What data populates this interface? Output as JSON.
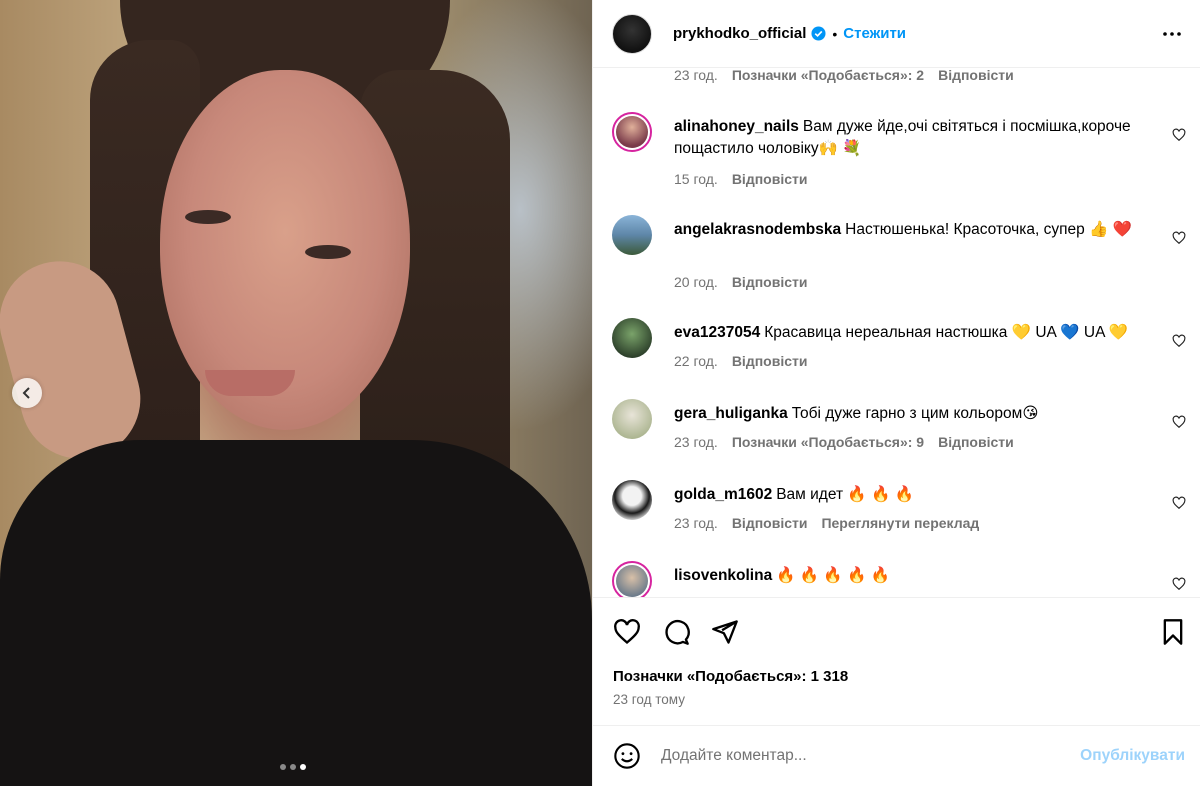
{
  "post": {
    "username": "prykhodko_official",
    "separator": "•",
    "follow_label": "Стежити",
    "carousel": {
      "total": 3,
      "active": 3
    }
  },
  "colors": {
    "accent": "#0095f6",
    "secondary_text": "#737373",
    "story_ring": "#d6249f"
  },
  "top_meta": {
    "time": "23 год.",
    "likes": "Позначки «Подобається»: 2",
    "reply": "Відповісти"
  },
  "comments": [
    {
      "user": "alinahoney_nails",
      "text": "Вам дуже йде,очі світяться і посмішка,короче пощастило чоловіку🙌 💐",
      "time": "15 год.",
      "likes": "",
      "reply": "Відповісти",
      "extra": ""
    },
    {
      "user": "angelakrasnodembska",
      "text": "Настюшенька! Красоточка, супер 👍 ❤️",
      "time": "20 год.",
      "likes": "",
      "reply": "Відповісти",
      "extra": ""
    },
    {
      "user": "eva1237054",
      "text": "Красавица нереальная настюшка 💛 UA 💙 UA 💛",
      "time": "22 год.",
      "likes": "",
      "reply": "Відповісти",
      "extra": ""
    },
    {
      "user": "gera_huliganka",
      "text": "Тобі дуже гарно з цим кольором😘",
      "time": "23 год.",
      "likes": "Позначки «Подобається»: 9",
      "reply": "Відповісти",
      "extra": ""
    },
    {
      "user": "golda_m1602",
      "text": "Вам идет 🔥 🔥 🔥",
      "time": "23 год.",
      "likes": "",
      "reply": "Відповісти",
      "extra": "Переглянути переклад"
    },
    {
      "user": "lisovenkolina",
      "text": "🔥 🔥 🔥 🔥 🔥",
      "time": "",
      "likes": "",
      "reply": "",
      "extra": ""
    }
  ],
  "footer": {
    "likes_label": "Позначки «Подобається»: 1 318",
    "posted": "23 год тому",
    "comment_placeholder": "Додайте коментар...",
    "post_label": "Опублікувати"
  },
  "icons": {
    "verified": "verified-badge-icon",
    "more": "more-options-icon",
    "like": "heart-icon",
    "comment": "comment-icon",
    "share": "share-icon",
    "save": "bookmark-icon",
    "emoji": "emoji-icon",
    "prev": "chevron-left-icon"
  }
}
